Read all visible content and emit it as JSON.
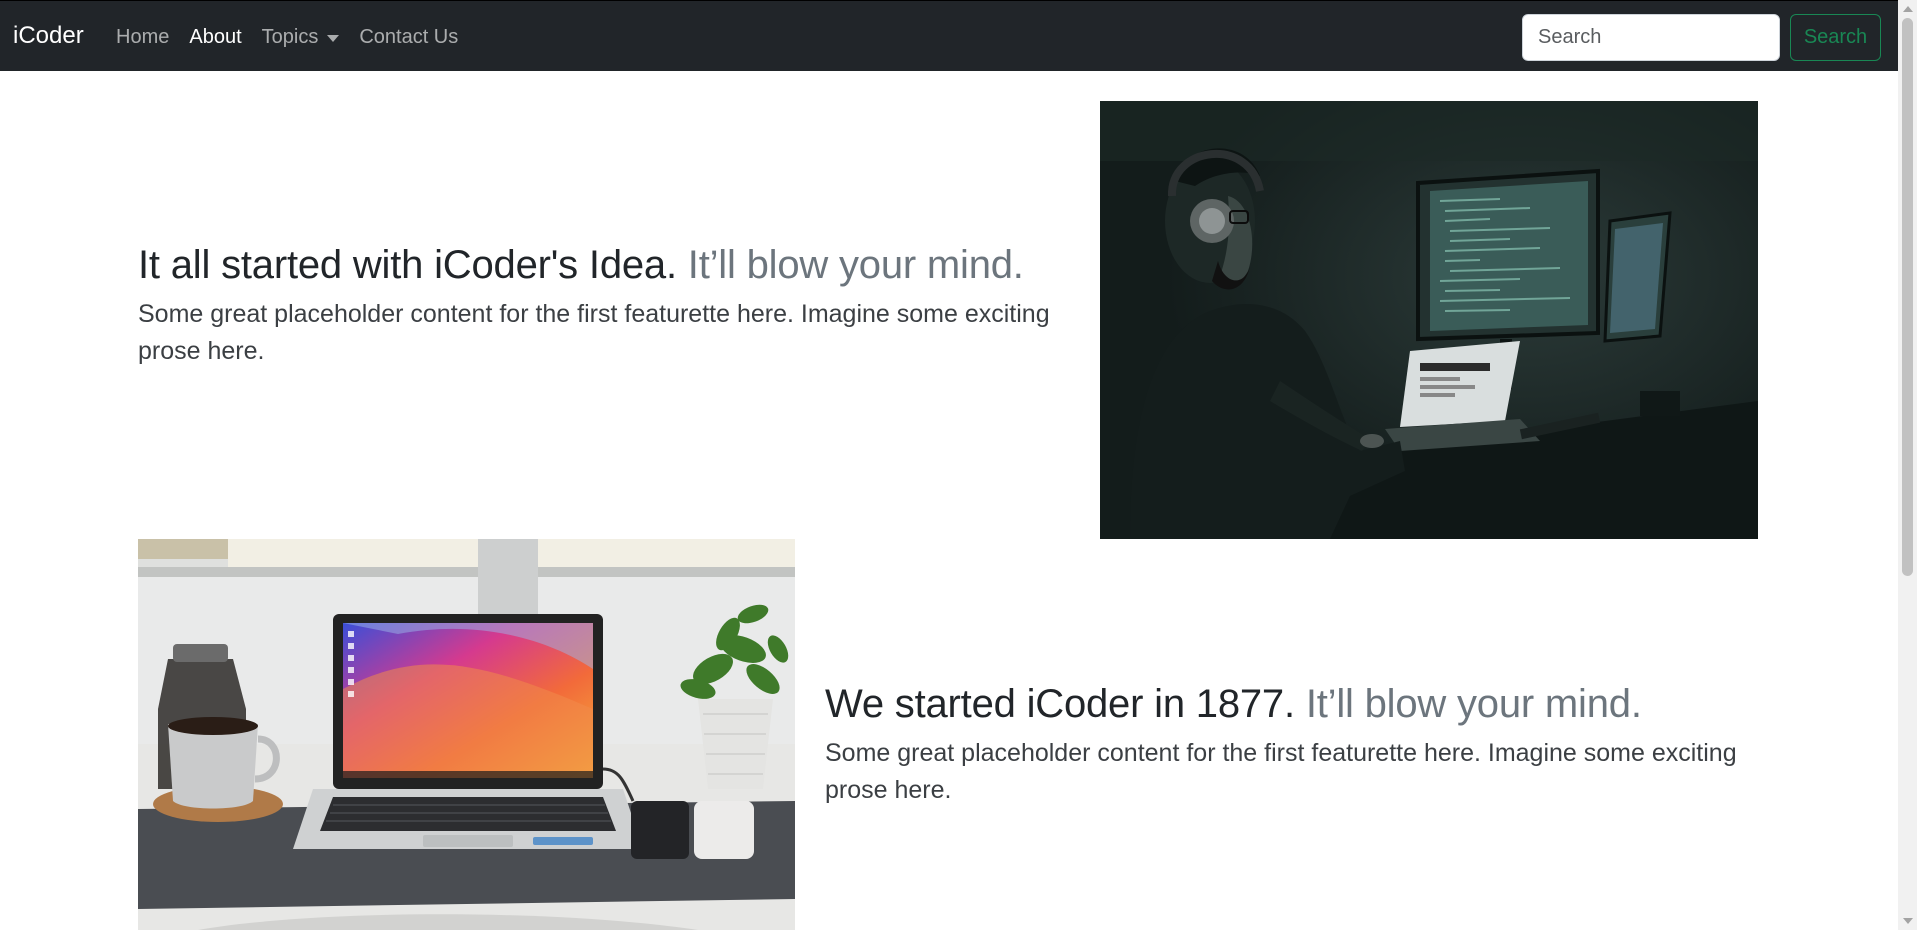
{
  "navbar": {
    "brand": "iCoder",
    "links": [
      {
        "label": "Home",
        "active": false
      },
      {
        "label": "About",
        "active": true
      },
      {
        "label": "Topics",
        "dropdown": true
      },
      {
        "label": "Contact Us",
        "active": false
      }
    ],
    "search": {
      "placeholder": "Search",
      "button_label": "Search"
    }
  },
  "featurettes": [
    {
      "heading": "It all started with iCoder's Idea.",
      "heading_muted": "It’ll blow your mind.",
      "lead": "Some great placeholder content for the first featurette here. Imagine some exciting prose here."
    },
    {
      "heading": "We started iCoder in 1877.",
      "heading_muted": "It’ll blow your mind.",
      "lead": "Some great placeholder content for the first featurette here. Imagine some exciting prose here."
    }
  ],
  "colors": {
    "navbar_bg": "#212529",
    "accent_success": "#198754",
    "muted_text": "#6c757d"
  }
}
